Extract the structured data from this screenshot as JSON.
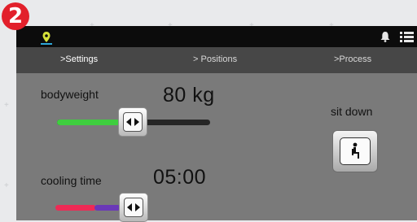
{
  "step_badge": "2",
  "nav": {
    "settings": ">Settings",
    "positions": "> Positions",
    "process": ">Process"
  },
  "bodyweight": {
    "label": "bodyweight",
    "value": "80 kg",
    "slider_level": 0.45
  },
  "cooling_time": {
    "label": "cooling time",
    "value": "05:00",
    "slider_level": 0.55
  },
  "sit_down": {
    "label": "sit down"
  },
  "colors": {
    "badge": "#e2202b",
    "bodyweight_fill": "#3fce3f",
    "cooling_red": "#ee2a55",
    "cooling_purple": "#6a38b8"
  },
  "icons": [
    "location-pin-icon",
    "bell-icon",
    "menu-icon",
    "left-right-arrows-icon",
    "sitting-person-icon"
  ]
}
